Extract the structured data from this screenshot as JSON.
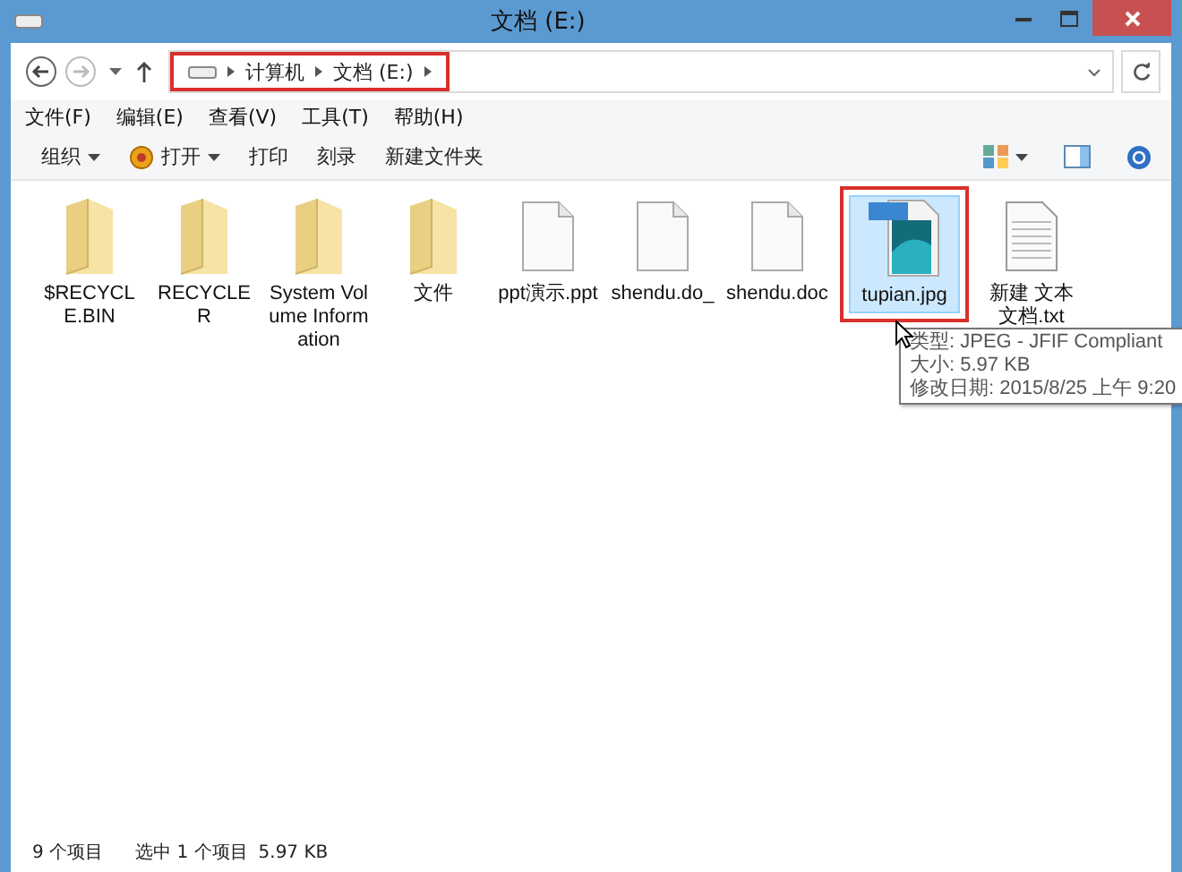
{
  "window": {
    "title": "文档 (E:)"
  },
  "address_bar": {
    "highlighted": true,
    "crumbs": [
      "计算机",
      "文档 (E:)"
    ]
  },
  "menu_bar": [
    "文件(F)",
    "编辑(E)",
    "查看(V)",
    "工具(T)",
    "帮助(H)"
  ],
  "toolbar": [
    {
      "label": "组织",
      "kind": "dropdown"
    },
    {
      "label": "打开",
      "kind": "open"
    },
    {
      "label": "打印",
      "kind": "plain"
    },
    {
      "label": "刻录",
      "kind": "plain"
    },
    {
      "label": "新建文件夹",
      "kind": "plain"
    }
  ],
  "files": [
    {
      "name": "$RECYCLE.BIN",
      "kind": "folder",
      "selected": false,
      "highlighted": false
    },
    {
      "name": "RECYCLER",
      "kind": "folder",
      "selected": false,
      "highlighted": false
    },
    {
      "name": "System Volume Information",
      "kind": "folder",
      "selected": false,
      "highlighted": false
    },
    {
      "name": "文件",
      "kind": "folder",
      "selected": false,
      "highlighted": false
    },
    {
      "name": "ppt演示.ppt",
      "kind": "document",
      "selected": false,
      "highlighted": false
    },
    {
      "name": "shendu.do_",
      "kind": "document",
      "selected": false,
      "highlighted": false
    },
    {
      "name": "shendu.doc",
      "kind": "document",
      "selected": false,
      "highlighted": false
    },
    {
      "name": "tupian.jpg",
      "kind": "jpg",
      "selected": true,
      "highlighted": true
    },
    {
      "name": "新建 文本文档.txt",
      "kind": "txt",
      "selected": false,
      "highlighted": false
    }
  ],
  "tooltip": [
    "类型: JPEG - JFIF Compliant",
    "大小: 5.97 KB",
    "修改日期: 2015/8/25 上午 9:20"
  ],
  "status_bar": {
    "item_count": "9 个项目",
    "selection": "选中 1 个项目",
    "size": "5.97 KB"
  }
}
